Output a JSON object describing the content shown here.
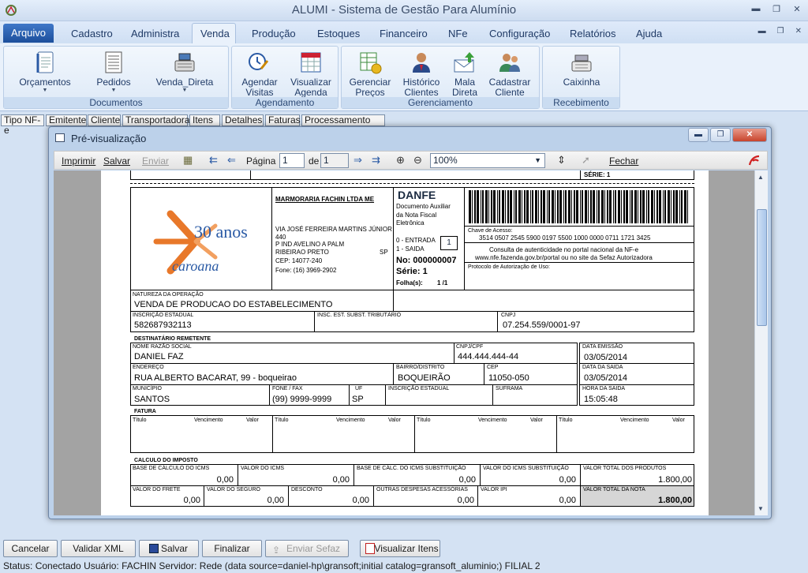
{
  "app": {
    "title": "ALUMI - Sistema de Gestão Para Alumínio"
  },
  "menu": {
    "arquivo": "Arquivo",
    "items": [
      "Cadastro",
      "Administra",
      "Venda",
      "Produção",
      "Estoques",
      "Financeiro",
      "NFe",
      "Configuração",
      "Relatórios",
      "Ajuda"
    ]
  },
  "ribbon": {
    "documentos": {
      "label": "Documentos",
      "buttons": [
        "Orçamentos",
        "Pedidos",
        "Venda_Direta"
      ]
    },
    "agendamento": {
      "label": "Agendamento",
      "buttons": [
        [
          "Agendar",
          "Visitas"
        ],
        [
          "Visualizar",
          "Agenda"
        ]
      ]
    },
    "gerenciamento": {
      "label": "Gerenciamento",
      "buttons": [
        [
          "Gerenciar",
          "Preços"
        ],
        [
          "Histórico",
          "Clientes"
        ],
        [
          "Mala",
          "Direta"
        ],
        [
          "Cadastrar",
          "Cliente"
        ]
      ]
    },
    "recebimento": {
      "label": "Recebimento",
      "buttons": [
        "Caixinha"
      ]
    }
  },
  "tabs": [
    "Tipo NF-e",
    "Emitente",
    "Cliente",
    "Transportadora",
    "Itens",
    "Detalhes",
    "Faturas",
    "Processamento Lote"
  ],
  "preview": {
    "title": "Pré-visualização",
    "toolbar": {
      "print": "Imprimir",
      "save": "Salvar",
      "send": "Enviar",
      "page_label": "Página",
      "page": "1",
      "of_label": "de",
      "total": "1",
      "zoom": "100%",
      "close": "Fechar"
    }
  },
  "danfe": {
    "serie_top": "SÉRIE: 1",
    "company": "MARMORARIA FACHIN LTDA ME",
    "logo_text": "30 anos",
    "logo_brand": "caroana",
    "address": [
      "VIA JOSÉ FERREIRA MARTINS JÚNIOR",
      "440",
      "P IND AVELINO A PALM",
      "RIBEIRAO PRETO",
      "CEP: 14077-240",
      "Fone: (16) 3969-2902"
    ],
    "state": "SP",
    "title": "DANFE",
    "subtitle": [
      "Documento Auxiliar",
      "da Nota Fiscal",
      "Eletrônica"
    ],
    "entrada": "0 - ENTRADA",
    "saida": "1 - SAIDA",
    "tipo": "1",
    "numero": "No: 000000007",
    "serie": "Série: 1",
    "folha_label": "Folha(s):",
    "folha": "1 /1",
    "chave_label": "Chave de Acesso:",
    "chave": "3514 0507 2545 5900 0197 5500 1000 0000 0711 1721 3425",
    "consulta": [
      "Consulta de autenticidade no portal nacional da NF-e",
      "www.nfe.fazenda.gov.br/portal ou no site da Sefaz Autorizadora"
    ],
    "protocolo_label": "Protocolo de Autorização de Uso:",
    "natureza_label": "NATUREZA DA OPERAÇÃO",
    "natureza": "VENDA DE PRODUCAO DO ESTABELECIMENTO",
    "ie_label": "INSCRIÇÃO ESTADUAL",
    "ie": "582687932113",
    "iest_label": "INSC. EST. SUBST. TRIBUTÁRIO",
    "cnpj_label": "CNPJ",
    "cnpj": "07.254.559/0001-97",
    "dest": {
      "section": "DESTINATÁRIO REMETENTE",
      "nome_label": "NOME RAZÃO SOCIAL",
      "nome": "DANIEL FAZ",
      "cpf_label": "CNPJ/CPF",
      "cpf": "444.444.444-44",
      "emissao_label": "DATA EMISSÃO",
      "emissao": "03/05/2014",
      "endereco_label": "ENDEREÇO",
      "endereco": "RUA ALBERTO BACARAT, 99 - boqueirao",
      "bairro_label": "BAIRRO/DISTRITO",
      "bairro": "BOQUEIRÃO",
      "cep_label": "CEP",
      "cep": "11050-050",
      "saida_label": "DATA DA SAIDA",
      "saida": "03/05/2014",
      "municipio_label": "MUNICÍPIO",
      "municipio": "SANTOS",
      "fone_label": "FONE / FAX",
      "fone": "(99) 9999-9999",
      "uf_label": "UF",
      "uf": "SP",
      "ie_label": "INSCRIÇÃO ESTADUAL",
      "suframa_label": "SUFRAMA",
      "hora_label": "HORA DA SAIDA",
      "hora": "15:05:48"
    },
    "fatura": {
      "section": "FATURA",
      "cols": [
        "Título",
        "Vencimento",
        "Valor"
      ]
    },
    "imposto": {
      "section": "CALCULO DO IMPOSTO",
      "row1": [
        {
          "label": "BASE DE CÁLCULO DO ICMS",
          "value": "0,00"
        },
        {
          "label": "VALOR DO ICMS",
          "value": "0,00"
        },
        {
          "label": "BASE DE CÁLC. DO ICMS SUBSTITUIÇÃO",
          "value": "0,00"
        },
        {
          "label": "VALOR DO ICMS SUBSTITUIÇÃO",
          "value": "0,00"
        },
        {
          "label": "VALOR TOTAL DOS PRODUTOS",
          "value": "1.800,00"
        }
      ],
      "row2": [
        {
          "label": "VALOR DO FRETE",
          "value": "0,00"
        },
        {
          "label": "VALOR DO SEGURO",
          "value": "0,00"
        },
        {
          "label": "DESCONTO",
          "value": "0,00"
        },
        {
          "label": "OUTRAS DESPESAS ACESSÓRIAS",
          "value": "0,00"
        },
        {
          "label": "VALOR IPI",
          "value": "0,00"
        },
        {
          "label": "VALOR TOTAL DA NOTA",
          "value": "1.800,00"
        }
      ]
    }
  },
  "bottom": {
    "cancel": "Cancelar",
    "validate": "Validar XML",
    "save": "Salvar",
    "finish": "Finalizar",
    "send": "Enviar Sefaz",
    "view": "Visualizar Itens"
  },
  "status": "Status: Conectado   Usuário: FACHIN  Servidor: Rede (data source=daniel-hp\\gransoft;initial catalog=gransoft_aluminio;)  FILIAL 2"
}
